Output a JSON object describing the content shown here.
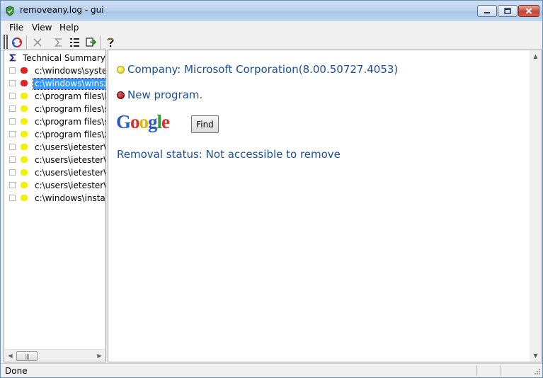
{
  "window": {
    "title": "removeany.log - gui"
  },
  "menu": {
    "items": [
      {
        "label": "File"
      },
      {
        "label": "View"
      },
      {
        "label": "Help"
      }
    ]
  },
  "tree": {
    "header_label": "Technical Summary",
    "rows": [
      {
        "label": "c:\\windows\\system",
        "status_color": "#e82020",
        "selected": false
      },
      {
        "label": "c:\\windows\\winsxs",
        "status_color": "#e82020",
        "selected": true
      },
      {
        "label": "c:\\program files\\bi",
        "status_color": "#f5f000",
        "selected": false
      },
      {
        "label": "c:\\program files\\sy",
        "status_color": "#f5f000",
        "selected": false
      },
      {
        "label": "c:\\program files\\sy",
        "status_color": "#f5f000",
        "selected": false
      },
      {
        "label": "c:\\program files\\zi",
        "status_color": "#f5f000",
        "selected": false
      },
      {
        "label": "c:\\users\\ietester\\ap",
        "status_color": "#f5f000",
        "selected": false
      },
      {
        "label": "c:\\users\\ietester\\ap",
        "status_color": "#f5f000",
        "selected": false
      },
      {
        "label": "c:\\users\\ietester\\de",
        "status_color": "#f5f000",
        "selected": false
      },
      {
        "label": "c:\\users\\ietester\\de",
        "status_color": "#f5f000",
        "selected": false
      },
      {
        "label": "c:\\windows\\installe",
        "status_color": "#f5f000",
        "selected": false
      }
    ]
  },
  "detail": {
    "company_line": "Company: Microsoft Corporation(8.00.50727.4053)",
    "program_line": "New program.",
    "google_logo": "Google",
    "find_label": "Find",
    "removal_status": "Removal status: Not accessible to remove"
  },
  "status": {
    "text": "Done"
  },
  "colors": {
    "link_text": "#1a4f95",
    "selection": "#3399ff",
    "red_status": "#e82020",
    "yellow_status": "#f5f000"
  }
}
